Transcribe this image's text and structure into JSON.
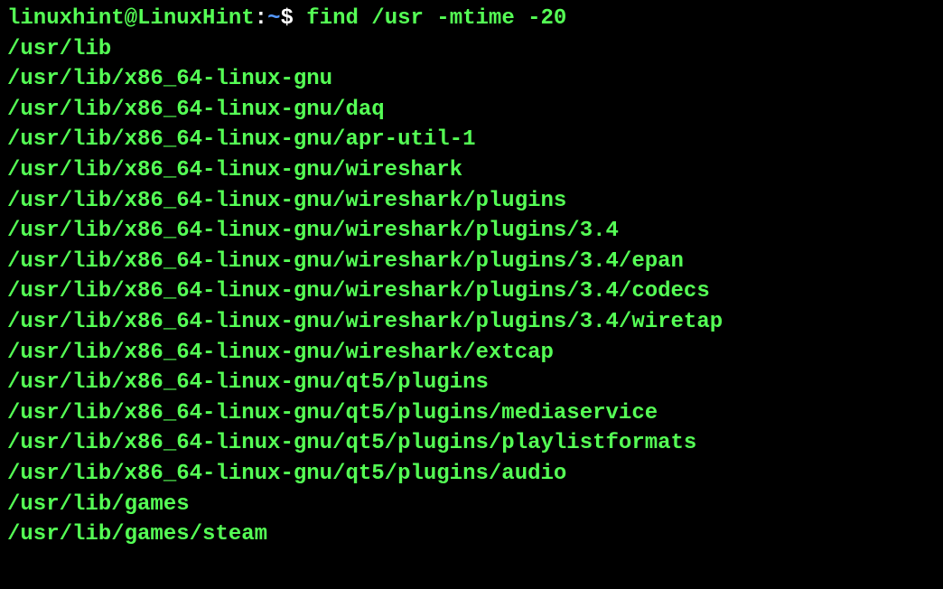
{
  "prompt": {
    "user": "linuxhint@LinuxHint",
    "colon": ":",
    "path": "~",
    "dollar": "$ ",
    "command": "find /usr -mtime -20"
  },
  "output": [
    "/usr/lib",
    "/usr/lib/x86_64-linux-gnu",
    "/usr/lib/x86_64-linux-gnu/daq",
    "/usr/lib/x86_64-linux-gnu/apr-util-1",
    "/usr/lib/x86_64-linux-gnu/wireshark",
    "/usr/lib/x86_64-linux-gnu/wireshark/plugins",
    "/usr/lib/x86_64-linux-gnu/wireshark/plugins/3.4",
    "/usr/lib/x86_64-linux-gnu/wireshark/plugins/3.4/epan",
    "/usr/lib/x86_64-linux-gnu/wireshark/plugins/3.4/codecs",
    "/usr/lib/x86_64-linux-gnu/wireshark/plugins/3.4/wiretap",
    "/usr/lib/x86_64-linux-gnu/wireshark/extcap",
    "/usr/lib/x86_64-linux-gnu/qt5/plugins",
    "/usr/lib/x86_64-linux-gnu/qt5/plugins/mediaservice",
    "/usr/lib/x86_64-linux-gnu/qt5/plugins/playlistformats",
    "/usr/lib/x86_64-linux-gnu/qt5/plugins/audio",
    "/usr/lib/games",
    "/usr/lib/games/steam"
  ]
}
